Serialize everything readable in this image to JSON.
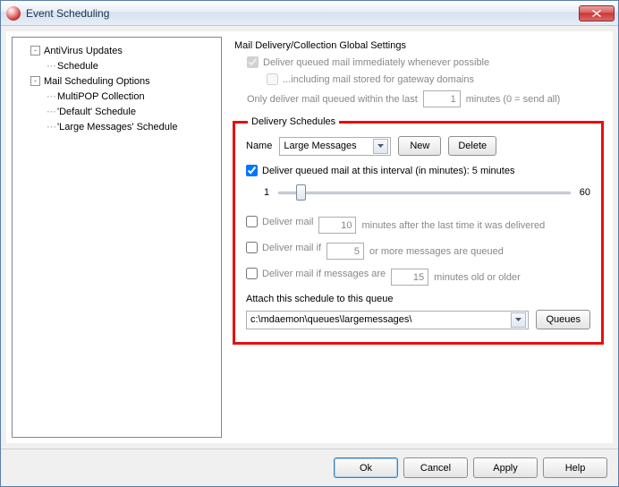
{
  "window": {
    "title": "Event Scheduling"
  },
  "tree": {
    "antivirus": "AntiVirus Updates",
    "schedule": "Schedule",
    "mail_sched": "Mail Scheduling Options",
    "multipop": "MultiPOP Collection",
    "default": "'Default' Schedule",
    "large": "'Large Messages' Schedule"
  },
  "global": {
    "heading": "Mail Delivery/Collection Global Settings",
    "deliver_immediate": "Deliver queued mail immediately whenever possible",
    "including_gateway": "...including mail stored for gateway domains",
    "only_deliver_prefix": "Only deliver mail queued within the last",
    "only_deliver_value": "1",
    "only_deliver_suffix": "minutes (0 = send all)"
  },
  "schedule": {
    "legend": "Delivery Schedules",
    "name_label": "Name",
    "name_value": "Large Messages",
    "new_btn": "New",
    "delete_btn": "Delete",
    "interval_label": "Deliver queued mail at this interval (in minutes): 5 minutes",
    "slider_min": "1",
    "slider_max": "60",
    "opt1_label": "Deliver mail",
    "opt1_value": "10",
    "opt1_suffix": "minutes after the last time it was delivered",
    "opt2_label": "Deliver mail if",
    "opt2_value": "5",
    "opt2_suffix": "or more messages are queued",
    "opt3_label": "Deliver mail if messages are",
    "opt3_value": "15",
    "opt3_suffix": "minutes old or older",
    "attach_label": "Attach this schedule to this queue",
    "queue_path": "c:\\mdaemon\\queues\\largemessages\\",
    "queues_btn": "Queues"
  },
  "footer": {
    "ok": "Ok",
    "cancel": "Cancel",
    "apply": "Apply",
    "help": "Help"
  }
}
